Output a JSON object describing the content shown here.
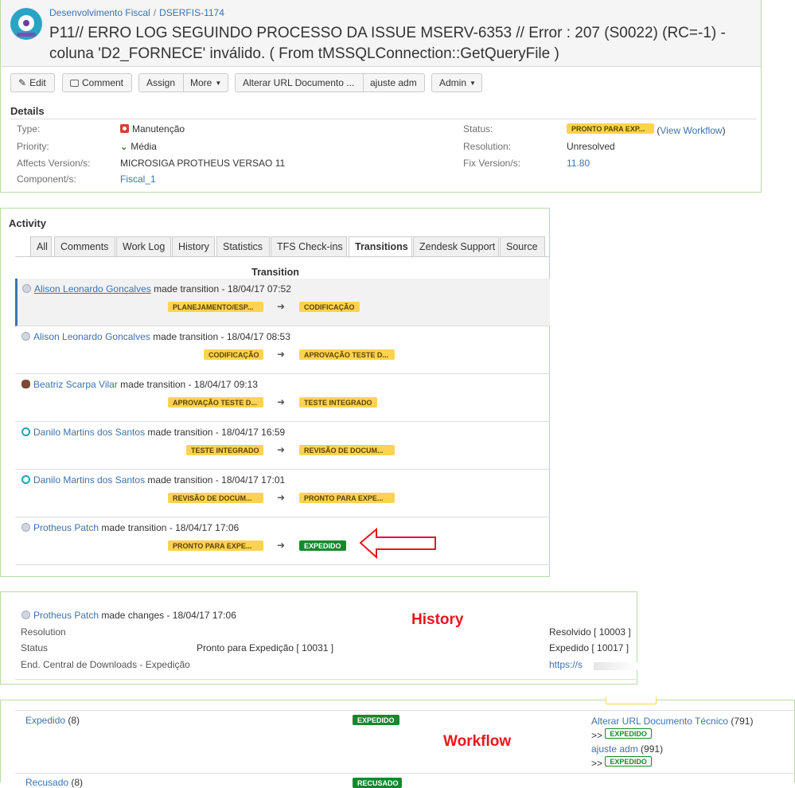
{
  "header": {
    "breadcrumbs": [
      "Desenvolvimento Fiscal",
      "DSERFIS-1174"
    ],
    "breadcrumb_separator": "/",
    "title_line1": "P11// ERRO LOG SEGUINDO PROCESSO DA ISSUE MSERV-6353 // Error : 207 (S0022) (RC=-1) -",
    "title_line2": "coluna 'D2_FORNECE' inválido. ( From tMSSQLConnection::GetQueryFile )"
  },
  "toolbar": {
    "edit": "Edit",
    "comment": "Comment",
    "assign": "Assign",
    "more": "More",
    "alterar_url": "Alterar URL Documento ...",
    "ajuste_adm": "ajuste adm",
    "admin": "Admin"
  },
  "details": {
    "heading": "Details",
    "type_label": "Type:",
    "type_value": "Manutenção",
    "priority_label": "Priority:",
    "priority_value": "Média",
    "affects_label": "Affects Version/s:",
    "affects_value": "MICROSIGA PROTHEUS VERSAO 11",
    "component_label": "Component/s:",
    "component_value": "Fiscal_1",
    "status_label": "Status:",
    "status_value": "PRONTO PARA EXP...",
    "view_workflow": "View Workflow",
    "resolution_label": "Resolution:",
    "resolution_value": "Unresolved",
    "fix_label": "Fix Version/s:",
    "fix_value": "11.80"
  },
  "activity": {
    "heading": "Activity",
    "tabs": [
      "All",
      "Comments",
      "Work Log",
      "History",
      "Statistics",
      "TFS Check-ins",
      "Transitions",
      "Zendesk Support",
      "Source"
    ],
    "active_tab": "Transitions",
    "section_title": "Transition",
    "made_transition": "made transition -",
    "entries": [
      {
        "user": "Alison Leonardo Goncalves",
        "time": "18/04/17 07:52",
        "from": "PLANEJAMENTO/ESP...",
        "to": "CODIFICAÇÃO"
      },
      {
        "user": "Alison Leonardo Goncalves",
        "time": "18/04/17 08:53",
        "from": "CODIFICAÇÃO",
        "to": "APROVAÇÃO TESTE D..."
      },
      {
        "user": "Beatriz Scarpa Vilar",
        "time": "18/04/17 09:13",
        "from": "APROVAÇÃO TESTE D...",
        "to": "TESTE INTEGRADO"
      },
      {
        "user": "Danilo Martins dos Santos",
        "time": "18/04/17 16:59",
        "from": "TESTE INTEGRADO",
        "to": "REVISÃO DE DOCUM..."
      },
      {
        "user": "Danilo Martins dos Santos",
        "time": "18/04/17 17:01",
        "from": "REVISÃO DE DOCUM...",
        "to": "PRONTO PARA EXPE..."
      },
      {
        "user": "Protheus Patch",
        "time": "18/04/17 17:06",
        "from": "PRONTO PARA EXPE...",
        "to": "EXPEDIDO"
      }
    ]
  },
  "history": {
    "annotation": "History",
    "user": "Protheus Patch",
    "action": "made changes - 18/04/17 17:06",
    "rows": [
      {
        "field": "Resolution",
        "old": "",
        "new": "Resolvido [ 10003 ]"
      },
      {
        "field": "Status",
        "old": "Pronto para Expedição [ 10031 ]",
        "new": "Expedido [ 10017 ]"
      },
      {
        "field": "End. Central de Downloads - Expedição",
        "old": "",
        "new": "https://s"
      }
    ]
  },
  "workflow": {
    "annotation": "Workflow",
    "status_link": "Expedido",
    "status_count": "(8)",
    "status_lozenge": "EXPEDIDO",
    "transitions": [
      {
        "name": "Alterar URL Documento Técnico",
        "count": "(791)",
        "prefix": ">>",
        "target": "EXPEDIDO"
      },
      {
        "name": "ajuste adm",
        "count": "(991)",
        "prefix": ">>",
        "target": "EXPEDIDO"
      }
    ],
    "next_status_link": "Recusado",
    "next_status_count": "(8)",
    "next_status_lozenge": "RECUSADO"
  },
  "colors": {
    "link": "#3b73af",
    "lozenge_yellow": "#ffd351",
    "lozenge_green": "#14892c",
    "annotation_red": "#e8161b",
    "panel_border": "#b6dca3"
  }
}
